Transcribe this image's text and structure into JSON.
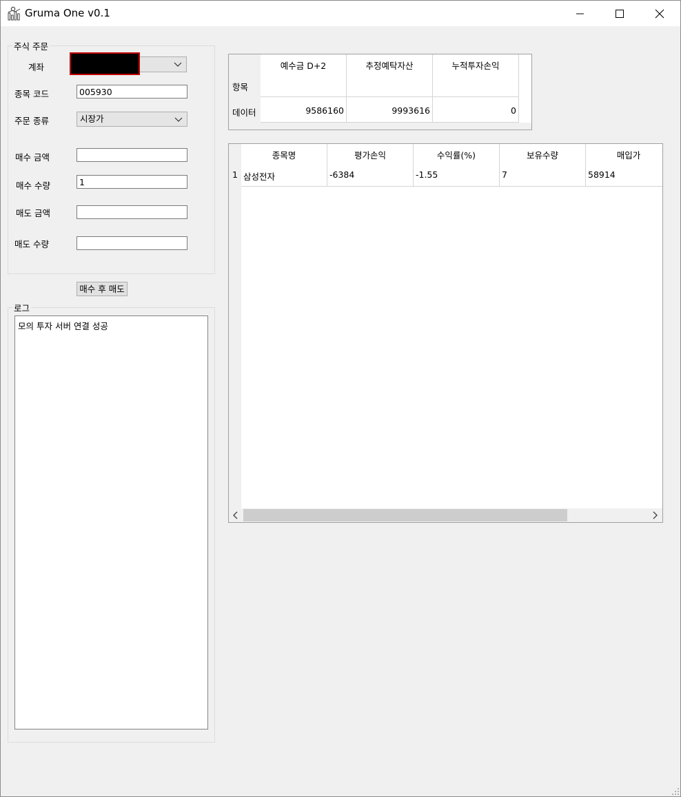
{
  "window": {
    "title": "Gruma One v0.1"
  },
  "order_group": {
    "title": "주식 주문",
    "account_label": "계좌",
    "code_label": "종목 코드",
    "code_value": "005930",
    "order_type_label": "주문 종류",
    "order_type_value": "시장가",
    "buy_amount_label": "매수 금액",
    "buy_amount_value": "",
    "buy_qty_label": "매수 수량",
    "buy_qty_value": "1",
    "sell_amount_label": "매도 금액",
    "sell_amount_value": "",
    "sell_qty_label": "매도 수량",
    "sell_qty_value": ""
  },
  "action_button": "매수 후 매도",
  "log_group": {
    "title": "로그",
    "lines": [
      "모의 투자 서버 연결 성공"
    ]
  },
  "summary_grid": {
    "row_header_title": "항목",
    "row_label": "데이터",
    "columns": [
      "예수금 D+2",
      "추정예탁자산",
      "누적투자손익"
    ],
    "values": [
      "9586160",
      "9993616",
      "0"
    ]
  },
  "holdings_grid": {
    "columns": [
      "종목명",
      "평가손익",
      "수익률(%)",
      "보유수량",
      "매입가"
    ],
    "rows": [
      {
        "index": "1",
        "cells": [
          "삼성전자",
          "-6384",
          "-1.55",
          "7",
          "58914"
        ]
      }
    ]
  },
  "icons": {
    "app": "chart-app-icon",
    "minimize": "minimize-icon",
    "maximize": "maximize-icon",
    "close": "close-icon",
    "dropdown": "chevron-down-icon",
    "scroll_left": "chevron-left-icon",
    "scroll_right": "chevron-right-icon",
    "resize": "resize-grip-icon"
  },
  "colors": {
    "account_redacted_fill": "#000000",
    "account_focus_border": "#c00000"
  }
}
